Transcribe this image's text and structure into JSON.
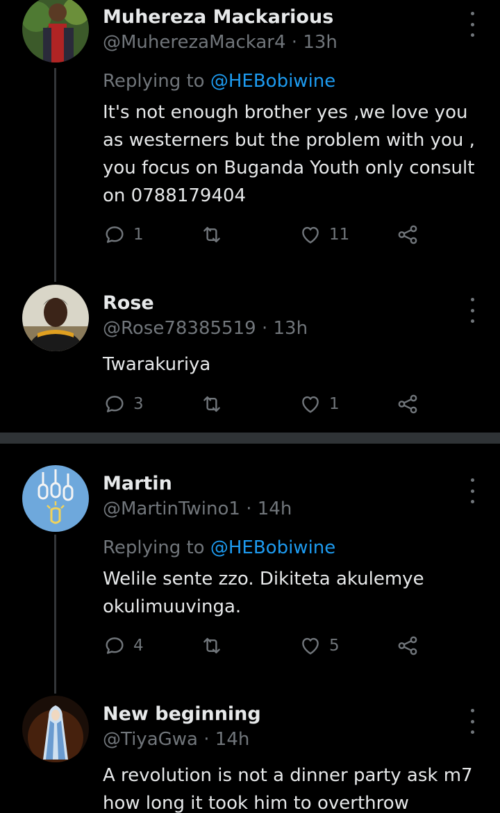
{
  "tweets": [
    {
      "name": "Muhereza Mackarious",
      "handle": "@MuherezaMackar4",
      "time": "13h",
      "replying_label": "Replying to",
      "replying_to": "@HEBobiwine",
      "text": "It's not enough brother yes ,we love you as westerners but the problem with you , you focus on Buganda Youth only consult on 0788179404",
      "replies": "1",
      "retweets": "",
      "likes": "11"
    },
    {
      "name": "Rose",
      "handle": "@Rose78385519",
      "time": "13h",
      "text": "Twarakuriya",
      "replies": "3",
      "retweets": "",
      "likes": "1"
    },
    {
      "name": "Martin",
      "handle": "@MartinTwino1",
      "time": "14h",
      "replying_label": "Replying to",
      "replying_to": "@HEBobiwine",
      "text": "Welile sente zzo. Dikiteta akulemye okulimuuvinga.",
      "replies": "4",
      "retweets": "",
      "likes": "5"
    },
    {
      "name": "New beginning",
      "handle": "@TiyaGwa",
      "time": "14h",
      "text": "A revolution is not a dinner party ask m7 how long it took him to overthrow"
    }
  ],
  "separator": "·",
  "colors": {
    "background": "#000000",
    "text": "#e7e9ea",
    "secondary": "#71767b",
    "link": "#1d9bf0",
    "divider": "#2f3336"
  },
  "icons": [
    "reply-icon",
    "retweet-icon",
    "like-icon",
    "share-icon",
    "more-icon"
  ]
}
